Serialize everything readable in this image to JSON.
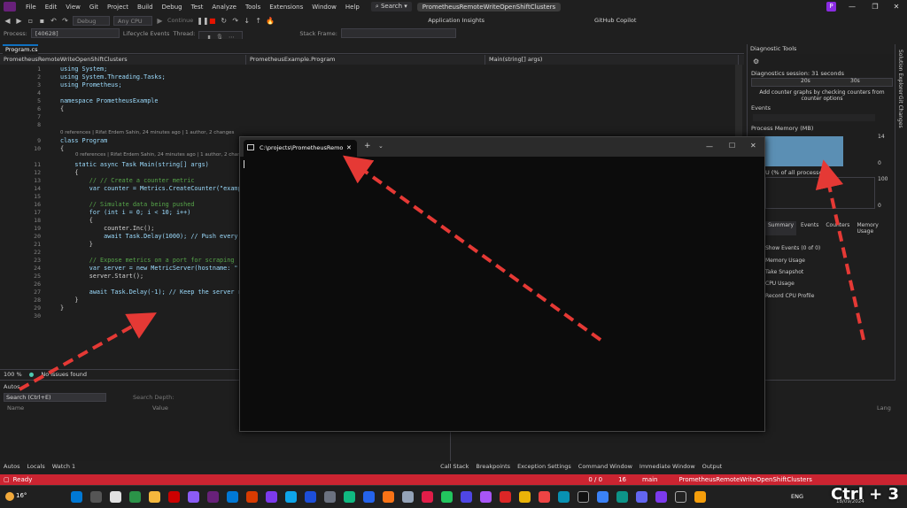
{
  "menu": {
    "items": [
      "File",
      "Edit",
      "View",
      "Git",
      "Project",
      "Build",
      "Debug",
      "Test",
      "Analyze",
      "Tools",
      "Extensions",
      "Window",
      "Help"
    ],
    "search": "Search",
    "solution": "PrometheusRemoteWriteOpenShiftClusters",
    "avatar": "P"
  },
  "toolbar": {
    "config": "Debug",
    "platform": "Any CPU",
    "continue": "Continue",
    "app_insights": "Application Insights",
    "copilot": "GitHub Copilot"
  },
  "toolbar2": {
    "process_label": "Process:",
    "process": "[40628] PrometheusRemoteWriteC",
    "lifecycle": "Lifecycle Events",
    "thread": "Thread:",
    "stack_frame": "Stack Frame:"
  },
  "tabs": {
    "active": "Program.cs"
  },
  "navbar": {
    "project": "PrometheusRemoteWriteOpenShiftClusters",
    "class": "PrometheusExample.Program",
    "member": "Main(string[] args)"
  },
  "code": {
    "lines": [
      {
        "n": "1",
        "t": "using System;"
      },
      {
        "n": "2",
        "t": "using System.Threading.Tasks;"
      },
      {
        "n": "3",
        "t": "using Prometheus;"
      },
      {
        "n": "4",
        "t": ""
      },
      {
        "n": "5",
        "t": "namespace PrometheusExample"
      },
      {
        "n": "6",
        "t": "{"
      },
      {
        "n": "7",
        "t": ""
      },
      {
        "n": "8",
        "t": ""
      },
      {
        "n": "9",
        "t": "class Program"
      },
      {
        "n": "10",
        "t": "{"
      },
      {
        "n": "11",
        "t": "    static async Task Main(string[] args)"
      },
      {
        "n": "12",
        "t": "    {"
      },
      {
        "n": "13",
        "t": "        // // Create a counter metric"
      },
      {
        "n": "14",
        "t": "        var counter = Metrics.CreateCounter(\"examp"
      },
      {
        "n": "15",
        "t": ""
      },
      {
        "n": "16",
        "t": "        // Simulate data being pushed"
      },
      {
        "n": "17",
        "t": "        for (int i = 0; i < 10; i++)"
      },
      {
        "n": "18",
        "t": "        {"
      },
      {
        "n": "19",
        "t": "            counter.Inc();"
      },
      {
        "n": "20",
        "t": "            await Task.Delay(1000); // Push every"
      },
      {
        "n": "21",
        "t": "        }"
      },
      {
        "n": "22",
        "t": ""
      },
      {
        "n": "23",
        "t": "        // Expose metrics on a port for scraping"
      },
      {
        "n": "24",
        "t": "        var server = new MetricServer(hostname: \""
      },
      {
        "n": "25",
        "t": "        server.Start();"
      },
      {
        "n": "26",
        "t": ""
      },
      {
        "n": "27",
        "t": "        await Task.Delay(-1); // Keep the server r"
      },
      {
        "n": "28",
        "t": "    }"
      },
      {
        "n": "29",
        "t": "}"
      },
      {
        "n": "30",
        "t": ""
      }
    ],
    "codelens1": "0 references | Rifat Erdem Sahin, 24 minutes ago | 1 author, 2 changes",
    "codelens2": "0 references | Rifat Erdem Sahin, 24 minutes ago | 1 author, 2 changes"
  },
  "status": {
    "zoom": "100 %",
    "issues": "No issues found"
  },
  "autos": {
    "title": "Autos",
    "search": "Search (Ctrl+E)",
    "search_depth": "Search Depth:",
    "col_name": "Name",
    "col_value": "Value",
    "col_lang": "Lang"
  },
  "bottom_tabs_left": [
    "Autos",
    "Locals",
    "Watch 1"
  ],
  "bottom_tabs_right": [
    "Call Stack",
    "Breakpoints",
    "Exception Settings",
    "Command Window",
    "Immediate Window",
    "Output"
  ],
  "diag": {
    "title": "Diagnostic Tools",
    "session": "Diagnostics session: 31 seconds",
    "t1": "20s",
    "t2": "30s",
    "hint": "Add counter graphs by checking counters from counter options",
    "events": "Events",
    "memory": "Process Memory (MB)",
    "mem_max": "14",
    "mem_min": "0",
    "cpu": "U (% of all processors)",
    "cpu_max": "100",
    "cpu_min": "0",
    "tabs": [
      "Summary",
      "Events",
      "Counters",
      "Memory Usage"
    ],
    "show_events": "Show Events (0 of 0)",
    "memory_usage": "Memory Usage",
    "take_snapshot": "Take Snapshot",
    "cpu_usage": "CPU Usage",
    "record_cpu": "Record CPU Profile"
  },
  "side": {
    "solution_explorer": "Solution Explorer",
    "git_changes": "Git Changes"
  },
  "terminal": {
    "tab": "C:\\projects\\PrometheusRemo"
  },
  "statusbar": {
    "ready": "Ready",
    "errors": "0 / 0",
    "lines": "16",
    "branch": "main",
    "repo": "PrometheusRemoteWriteOpenShiftClusters"
  },
  "taskbar": {
    "weather": "16°",
    "lang": "ENG",
    "date": "18/09/2024",
    "overlay": "Ctrl + 3"
  }
}
